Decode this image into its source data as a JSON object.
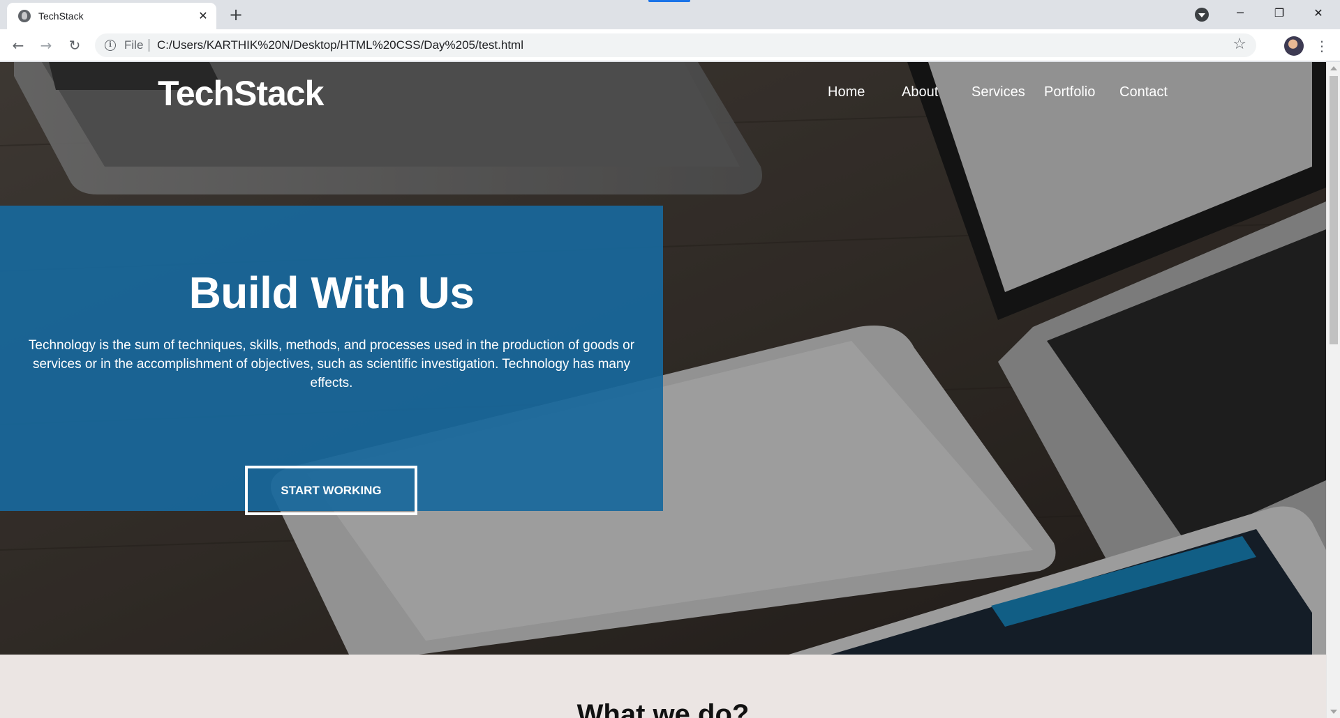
{
  "browser": {
    "tab_title": "TechStack",
    "tab_close": "✕",
    "new_tab": "+",
    "file_label": "File",
    "url": "C:/Users/KARTHIK%20N/Desktop/HTML%20CSS/Day%205/test.html",
    "window_min": "─",
    "window_max": "❐",
    "window_close": "✕",
    "back": "←",
    "forward": "→",
    "reload": "↻",
    "star": "☆",
    "menu": "⋮"
  },
  "site": {
    "logo": "TechStack",
    "nav": [
      "Home",
      "About",
      "Services",
      "Portfolio",
      "Contact"
    ]
  },
  "hero": {
    "title": "Build With Us",
    "text": "Technology is the sum of techniques, skills, methods, and processes used in the production of goods or services or in the accomplishment of objectives, such as scientific investigation. Technology has many effects.",
    "button": "START WORKING"
  },
  "section": {
    "title": "What we do?"
  },
  "colors": {
    "hero_overlay": "#18689c",
    "page_bg": "#ebe5e3",
    "chrome_bg": "#dee1e6"
  }
}
